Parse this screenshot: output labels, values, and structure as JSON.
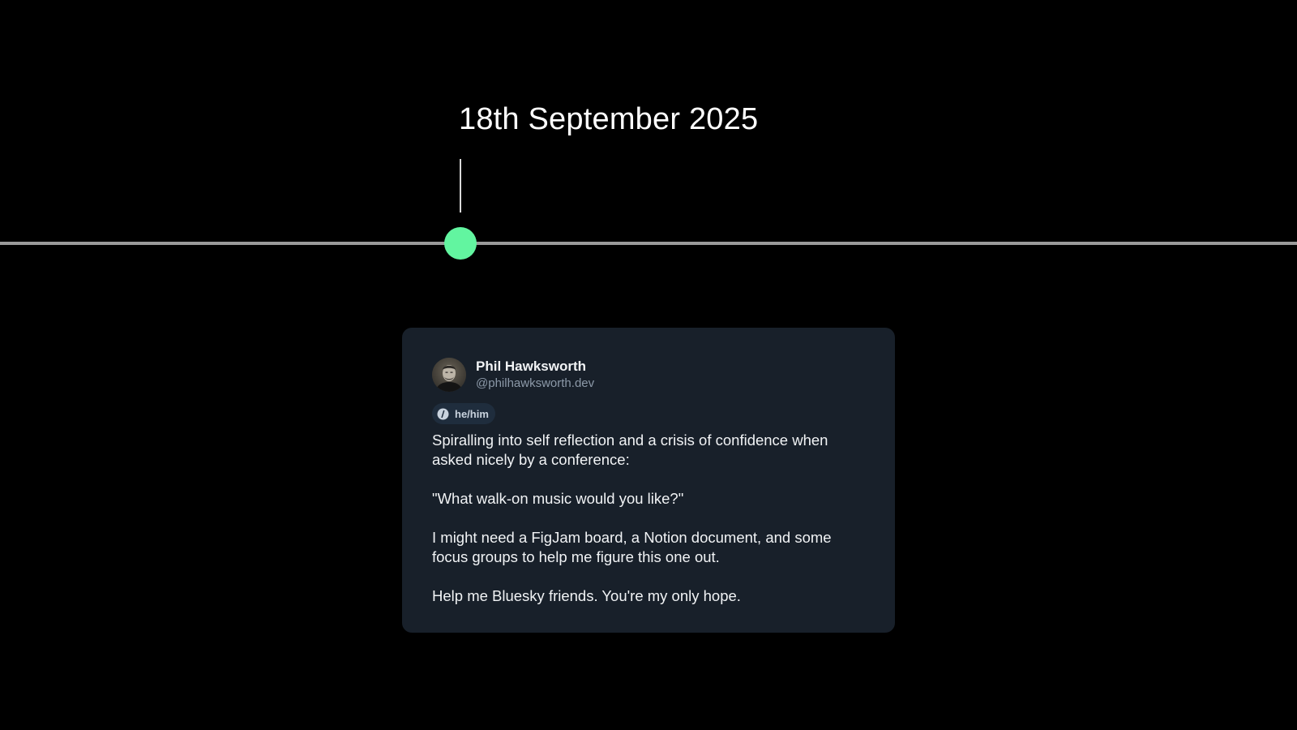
{
  "timeline": {
    "date_label": "18th September 2025",
    "marker_color": "#62f5a0",
    "line_color": "#9a9a9a"
  },
  "post": {
    "author": {
      "display_name": "Phil Hawksworth",
      "handle": "@philhawksworth.dev",
      "pronouns": "he/him",
      "avatar_icon": "person-photo-avatar"
    },
    "paragraphs": [
      "Spiralling into self reflection and a crisis of confidence when asked nicely by a conference:",
      "\"What walk-on music would you like?\"",
      "I might need a FigJam board, a Notion document, and some focus groups to help me figure this one out.",
      "Help me Bluesky friends. You're my only hope."
    ],
    "card_background": "#18202a"
  }
}
